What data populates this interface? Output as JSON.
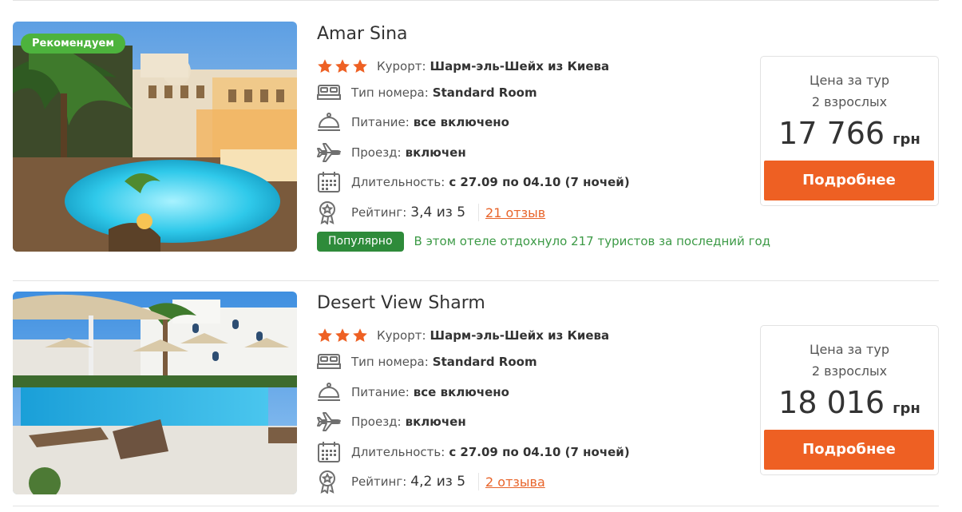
{
  "hotels": [
    {
      "name": "Amar Sina",
      "badge": "Рекомендуем",
      "stars": 3,
      "resort_label": "Курорт:",
      "resort": "Шарм-эль-Шейх из Киева",
      "room_label": "Тип номера:",
      "room": "Standard Room",
      "meal_label": "Питание:",
      "meal": "все включено",
      "transfer_label": "Проезд:",
      "transfer": "включен",
      "duration_label": "Длительность:",
      "duration": "с 27.09 по 04.10 (7 ночей)",
      "rating_label": "Рейтинг:",
      "rating": "3,4 из 5",
      "reviews": "21 отзыв",
      "popular_badge": "Популярно",
      "popular_text": "В этом отеле отдохнуло 217 туристов за последний год",
      "price_label_1": "Цена за тур",
      "price_label_2": "2 взрослых",
      "price": "17 766",
      "currency": "грн",
      "button": "Подробнее"
    },
    {
      "name": "Desert View Sharm",
      "stars": 3,
      "resort_label": "Курорт:",
      "resort": "Шарм-эль-Шейх из Киева",
      "room_label": "Тип номера:",
      "room": "Standard Room",
      "meal_label": "Питание:",
      "meal": "все включено",
      "transfer_label": "Проезд:",
      "transfer": "включен",
      "duration_label": "Длительность:",
      "duration": "с 27.09 по 04.10 (7 ночей)",
      "rating_label": "Рейтинг:",
      "rating": "4,2 из 5",
      "reviews": "2 отзыва",
      "price_label_1": "Цена за тур",
      "price_label_2": "2 взрослых",
      "price": "18 016",
      "currency": "грн",
      "button": "Подробнее"
    }
  ],
  "colors": {
    "accent": "#ee6023",
    "star": "#ee6023",
    "badge_green": "#4db33d",
    "popular_green": "#2e8b3a",
    "icon_gray": "#6f6f6f"
  },
  "icons": {
    "star": "star-icon",
    "room": "bed-icon",
    "meal": "cloche-icon",
    "transfer": "airplane-icon",
    "duration": "calendar-icon",
    "rating": "award-badge-icon"
  }
}
